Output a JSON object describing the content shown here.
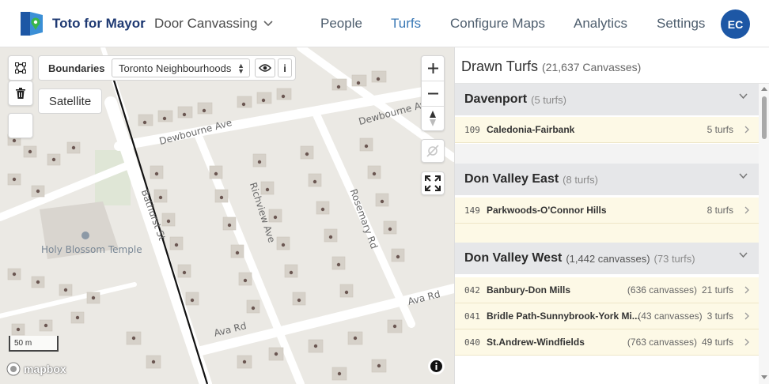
{
  "app": {
    "brand": "Toto for Mayor",
    "colon": ":",
    "campaign_type": "Door Canvassing"
  },
  "nav": {
    "items": [
      {
        "label": "People",
        "active": false
      },
      {
        "label": "Turfs",
        "active": true
      },
      {
        "label": "Configure Maps",
        "active": false
      },
      {
        "label": "Analytics",
        "active": false
      },
      {
        "label": "Settings",
        "active": false
      }
    ],
    "avatar_initials": "EC"
  },
  "map": {
    "boundaries_label": "Boundaries",
    "boundaries_value": "Toronto Neighbourhoods",
    "info_label": "i",
    "satellite_label": "Satellite",
    "scale_label": "50 m",
    "attribution_logo": "mapbox",
    "street_labels": [
      "Dewbourne Ave",
      "Dewbourne Ave",
      "Richview Ave",
      "Rosemary Rd",
      "Bathurst St",
      "Ava Rd",
      "Ava Rd"
    ],
    "poi_label": "Holy Blossom Temple",
    "icons": [
      "draw-polygon-icon",
      "trash-icon",
      "zoom-in-icon",
      "zoom-out-icon",
      "compass-icon",
      "geolocate-icon",
      "fullscreen-icon",
      "info-icon",
      "eye-icon"
    ]
  },
  "panel": {
    "title": "Drawn Turfs",
    "title_sub": "(21,637 Canvasses)",
    "groups": [
      {
        "name": "Davenport",
        "meta": "(5 turfs)",
        "rows": [
          {
            "code": "109",
            "name": "Caledonia-Fairbank",
            "canvasses": "",
            "turfs": "5 turfs"
          }
        ]
      },
      {
        "name": "Don Valley East",
        "meta": "(8 turfs)",
        "rows": [
          {
            "code": "149",
            "name": "Parkwoods-O'Connor Hills",
            "canvasses": "",
            "turfs": "8 turfs"
          }
        ]
      },
      {
        "name": "Don Valley West",
        "meta_canvasses": "(1,442 canvasses)",
        "meta": "(73 turfs)",
        "rows": [
          {
            "code": "042",
            "name": "Banbury-Don Mills",
            "canvasses": "(636 canvasses)",
            "turfs": "21 turfs"
          },
          {
            "code": "041",
            "name": "Bridle Path-Sunnybrook-York Mi...",
            "canvasses": "(43 canvasses)",
            "turfs": "3 turfs"
          },
          {
            "code": "040",
            "name": "St.Andrew-Windfields",
            "canvasses": "(763 canvasses)",
            "turfs": "49 turfs"
          }
        ]
      }
    ]
  },
  "colors": {
    "brand": "#1f3a73",
    "nav_active": "#3a78b5",
    "avatar_bg": "#1d57a5",
    "group_header_bg": "#e6e7e9",
    "row_bg": "#fdf9e6",
    "map_bg": "#ebe9e4"
  }
}
